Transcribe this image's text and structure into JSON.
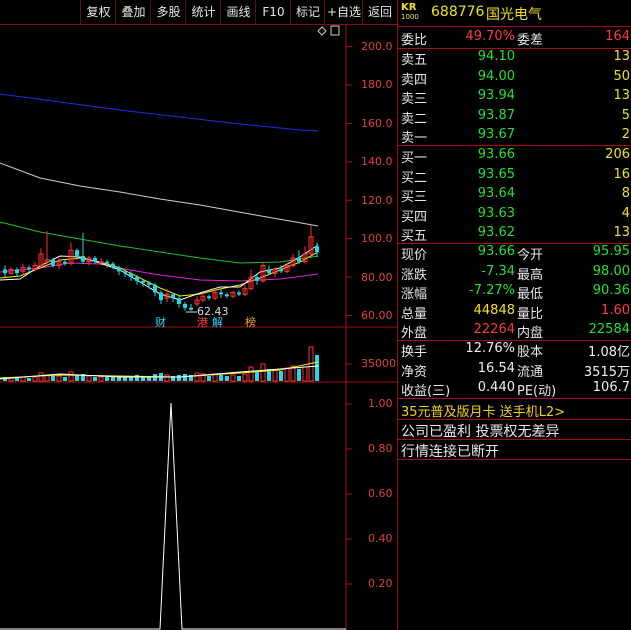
{
  "toolbar": {
    "items": [
      "复权",
      "叠加",
      "多股",
      "统计",
      "画线",
      "F10",
      "标记",
      "+自选",
      "返回"
    ]
  },
  "chart": {
    "price_ticks": [
      "200.0",
      "180.0",
      "160.0",
      "140.0",
      "120.0",
      "100.0",
      "80.00",
      "60.00"
    ],
    "volume_tick": "35000",
    "indicator_ticks": [
      "1.00",
      "0.80",
      "0.60",
      "0.40",
      "0.20"
    ],
    "low_marker": "62.43",
    "event_tags": [
      "财",
      "港",
      "解",
      "榜"
    ],
    "colors": {
      "up": "#ff3030",
      "down": "#20d8e8",
      "ma_blue": "#2030e0",
      "ma_gray": "#cfcfcf",
      "ma_green": "#20c020",
      "ma_magenta": "#e020e0",
      "ma_yellow": "#f0f000",
      "ma_white": "#ffffff"
    }
  },
  "quote": {
    "badge_top": "KR",
    "badge_bottom": "1000",
    "code": "688776",
    "name": "国光电气",
    "weibi_label": "委比",
    "weibi_value": "49.70%",
    "weicha_label": "委差",
    "weicha_value": "164",
    "sell": [
      {
        "label": "卖五",
        "price": "94.10",
        "vol": "13"
      },
      {
        "label": "卖四",
        "price": "94.00",
        "vol": "50"
      },
      {
        "label": "卖三",
        "price": "93.94",
        "vol": "13"
      },
      {
        "label": "卖二",
        "price": "93.87",
        "vol": "5"
      },
      {
        "label": "卖一",
        "price": "93.67",
        "vol": "2"
      }
    ],
    "buy": [
      {
        "label": "买一",
        "price": "93.66",
        "vol": "206"
      },
      {
        "label": "买二",
        "price": "93.65",
        "vol": "16"
      },
      {
        "label": "买三",
        "price": "93.64",
        "vol": "8"
      },
      {
        "label": "买四",
        "price": "93.63",
        "vol": "4"
      },
      {
        "label": "买五",
        "price": "93.62",
        "vol": "13"
      }
    ],
    "stats": [
      {
        "l1": "现价",
        "v1": "93.66",
        "c1": "green",
        "l2": "今开",
        "v2": "95.95",
        "c2": "green"
      },
      {
        "l1": "涨跌",
        "v1": "-7.34",
        "c1": "green",
        "l2": "最高",
        "v2": "98.00",
        "c2": "green"
      },
      {
        "l1": "涨幅",
        "v1": "-7.27%",
        "c1": "green",
        "l2": "最低",
        "v2": "90.36",
        "c2": "green"
      },
      {
        "l1": "总量",
        "v1": "44848",
        "c1": "yellow",
        "l2": "量比",
        "v2": "1.60",
        "c2": "red"
      },
      {
        "l1": "外盘",
        "v1": "22264",
        "c1": "red",
        "l2": "内盘",
        "v2": "22584",
        "c2": "green"
      }
    ],
    "fund": [
      {
        "l1": "换手",
        "v1": "12.76%",
        "l2": "股本",
        "v2": "1.08亿"
      },
      {
        "l1": "净资",
        "v1": "16.54",
        "l2": "流通",
        "v2": "3515万"
      },
      {
        "l1": "收益(三)",
        "v1": "0.440",
        "l2": "PE(动)",
        "v2": "106.7"
      }
    ],
    "promo": "35元普及版月卡 送手机L2>",
    "note1": "公司已盈利 投票权无差异",
    "note2": "行情连接已断开"
  }
}
